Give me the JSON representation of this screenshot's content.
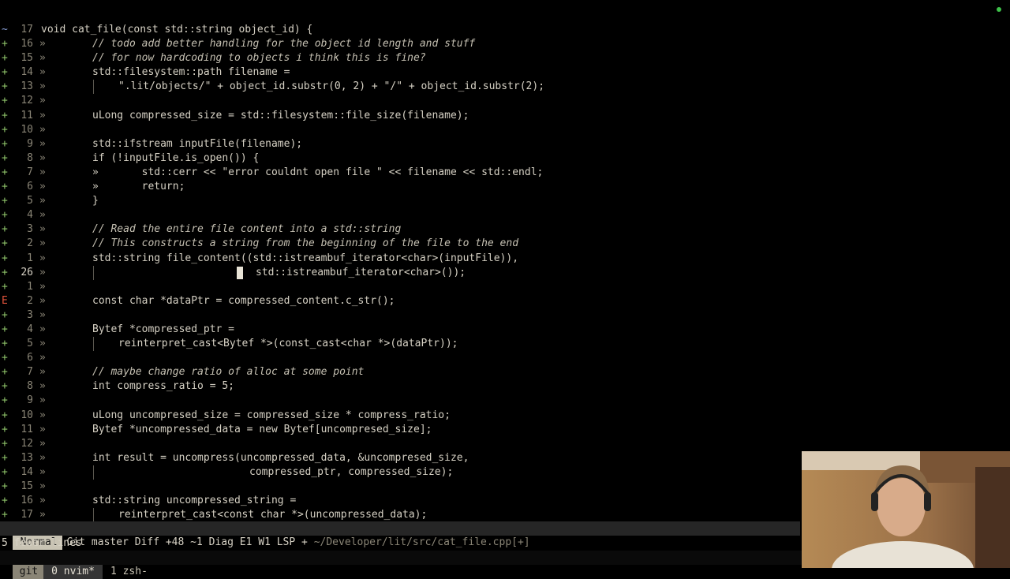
{
  "editor": {
    "lines": [
      {
        "sign": "~",
        "sign_class": "tilde",
        "num": "17",
        "fold": "",
        "indent": 52,
        "text": "void cat_file(const std::string object_id) {",
        "current": false
      },
      {
        "sign": "+",
        "sign_class": "add",
        "num": "16",
        "fold": "»",
        "indent": 117,
        "text": "// todo add better handling for the object id length and stuff",
        "current": false
      },
      {
        "sign": "+",
        "sign_class": "add",
        "num": "15",
        "fold": "»",
        "indent": 117,
        "text": "// for now hardcoding to objects i think this is fine?",
        "current": false
      },
      {
        "sign": "+",
        "sign_class": "add",
        "num": "14",
        "fold": "»",
        "indent": 117,
        "text": "std::filesystem::path filename =",
        "current": false
      },
      {
        "sign": "+",
        "sign_class": "add",
        "num": "13",
        "fold": "»",
        "indent": 150,
        "text": "\".lit/objects/\" + object_id.substr(0, 2) + \"/\" + object_id.substr(2);",
        "current": false
      },
      {
        "sign": "+",
        "sign_class": "add",
        "num": "12",
        "fold": "»",
        "indent": 117,
        "text": "",
        "current": false
      },
      {
        "sign": "+",
        "sign_class": "add",
        "num": "11",
        "fold": "»",
        "indent": 117,
        "text": "uLong compressed_size = std::filesystem::file_size(filename);",
        "current": false
      },
      {
        "sign": "+",
        "sign_class": "add",
        "num": "10",
        "fold": "»",
        "indent": 117,
        "text": "",
        "current": false
      },
      {
        "sign": "+",
        "sign_class": "add",
        "num": "9",
        "fold": "»",
        "indent": 117,
        "text": "std::ifstream inputFile(filename);",
        "current": false
      },
      {
        "sign": "+",
        "sign_class": "add",
        "num": "8",
        "fold": "»",
        "indent": 117,
        "text": "if (!inputFile.is_open()) {",
        "current": false
      },
      {
        "sign": "+",
        "sign_class": "add",
        "num": "7",
        "fold": "»",
        "indent": 117,
        "text": "»       std::cerr << \"error couldnt open file \" << filename << std::endl;",
        "current": false
      },
      {
        "sign": "+",
        "sign_class": "add",
        "num": "6",
        "fold": "»",
        "indent": 117,
        "text": "»       return;",
        "current": false
      },
      {
        "sign": "+",
        "sign_class": "add",
        "num": "5",
        "fold": "»",
        "indent": 117,
        "text": "}",
        "current": false
      },
      {
        "sign": "+",
        "sign_class": "add",
        "num": "4",
        "fold": "»",
        "indent": 117,
        "text": "",
        "current": false
      },
      {
        "sign": "+",
        "sign_class": "add",
        "num": "3",
        "fold": "»",
        "indent": 117,
        "text": "// Read the entire file content into a std::string",
        "current": false
      },
      {
        "sign": "+",
        "sign_class": "add",
        "num": "2",
        "fold": "»",
        "indent": 117,
        "text": "// This constructs a string from the beginning of the file to the end",
        "current": false
      },
      {
        "sign": "+",
        "sign_class": "add",
        "num": "1",
        "fold": "»",
        "indent": 117,
        "text": "std::string file_content((std::istreambuf_iterator<char>(inputFile)),",
        "current": false
      },
      {
        "sign": "+",
        "sign_class": "add",
        "num": "26",
        "fold": "»",
        "indent": 324,
        "text": "std::istreambuf_iterator<char>());",
        "current": true
      },
      {
        "sign": "+",
        "sign_class": "add",
        "num": "1",
        "fold": "»",
        "indent": 117,
        "text": "",
        "current": false
      },
      {
        "sign": "E",
        "sign_class": "err",
        "num": "2",
        "fold": "»",
        "indent": 117,
        "text": "const char *dataPtr = compressed_content.c_str();",
        "current": false
      },
      {
        "sign": "+",
        "sign_class": "add",
        "num": "3",
        "fold": "»",
        "indent": 117,
        "text": "",
        "current": false
      },
      {
        "sign": "+",
        "sign_class": "add",
        "num": "4",
        "fold": "»",
        "indent": 117,
        "text": "Bytef *compressed_ptr =",
        "current": false
      },
      {
        "sign": "+",
        "sign_class": "add",
        "num": "5",
        "fold": "»",
        "indent": 150,
        "text": "reinterpret_cast<Bytef *>(const_cast<char *>(dataPtr));",
        "current": false
      },
      {
        "sign": "+",
        "sign_class": "add",
        "num": "6",
        "fold": "»",
        "indent": 117,
        "text": "",
        "current": false
      },
      {
        "sign": "+",
        "sign_class": "add",
        "num": "7",
        "fold": "»",
        "indent": 117,
        "text": "// maybe change ratio of alloc at some point",
        "current": false
      },
      {
        "sign": "+",
        "sign_class": "add",
        "num": "8",
        "fold": "»",
        "indent": 117,
        "text": "int compress_ratio = 5;",
        "current": false
      },
      {
        "sign": "+",
        "sign_class": "add",
        "num": "9",
        "fold": "»",
        "indent": 117,
        "text": "",
        "current": false
      },
      {
        "sign": "+",
        "sign_class": "add",
        "num": "10",
        "fold": "»",
        "indent": 117,
        "text": "uLong uncompresed_size = compressed_size * compress_ratio;",
        "current": false
      },
      {
        "sign": "+",
        "sign_class": "add",
        "num": "11",
        "fold": "»",
        "indent": 117,
        "text": "Bytef *uncompressed_data = new Bytef[uncompresed_size];",
        "current": false
      },
      {
        "sign": "+",
        "sign_class": "add",
        "num": "12",
        "fold": "»",
        "indent": 117,
        "text": "",
        "current": false
      },
      {
        "sign": "+",
        "sign_class": "add",
        "num": "13",
        "fold": "»",
        "indent": 117,
        "text": "int result = uncompress(uncompressed_data, &uncompresed_size,",
        "current": false
      },
      {
        "sign": "+",
        "sign_class": "add",
        "num": "14",
        "fold": "»",
        "indent": 316,
        "text": "compressed_ptr, compressed_size);",
        "current": false
      },
      {
        "sign": "+",
        "sign_class": "add",
        "num": "15",
        "fold": "»",
        "indent": 117,
        "text": "",
        "current": false
      },
      {
        "sign": "+",
        "sign_class": "add",
        "num": "16",
        "fold": "»",
        "indent": 117,
        "text": "std::string uncompressed_string =",
        "current": false
      },
      {
        "sign": "+",
        "sign_class": "add",
        "num": "17",
        "fold": "»",
        "indent": 150,
        "text": "reinterpret_cast<const char *>(uncompressed_data);",
        "current": false
      }
    ]
  },
  "statusline": {
    "mode": "Normal",
    "info": "Git master Diff +48 ~1 Diag E1 W1 LSP +",
    "path": "~/Developer/lit/src/cat_file.cpp[+]"
  },
  "cmdline": "5 fewer lines",
  "tmux": {
    "session": "git",
    "windows": [
      {
        "label": "0 nvim*",
        "active": true
      },
      {
        "label": "1 zsh-",
        "active": false
      }
    ]
  },
  "colors": {
    "background": "#000000",
    "add_sign": "#8fc46a",
    "error_sign": "#e0533b",
    "statusline_bg": "#262626",
    "mode_bg": "#c9c4b4"
  }
}
